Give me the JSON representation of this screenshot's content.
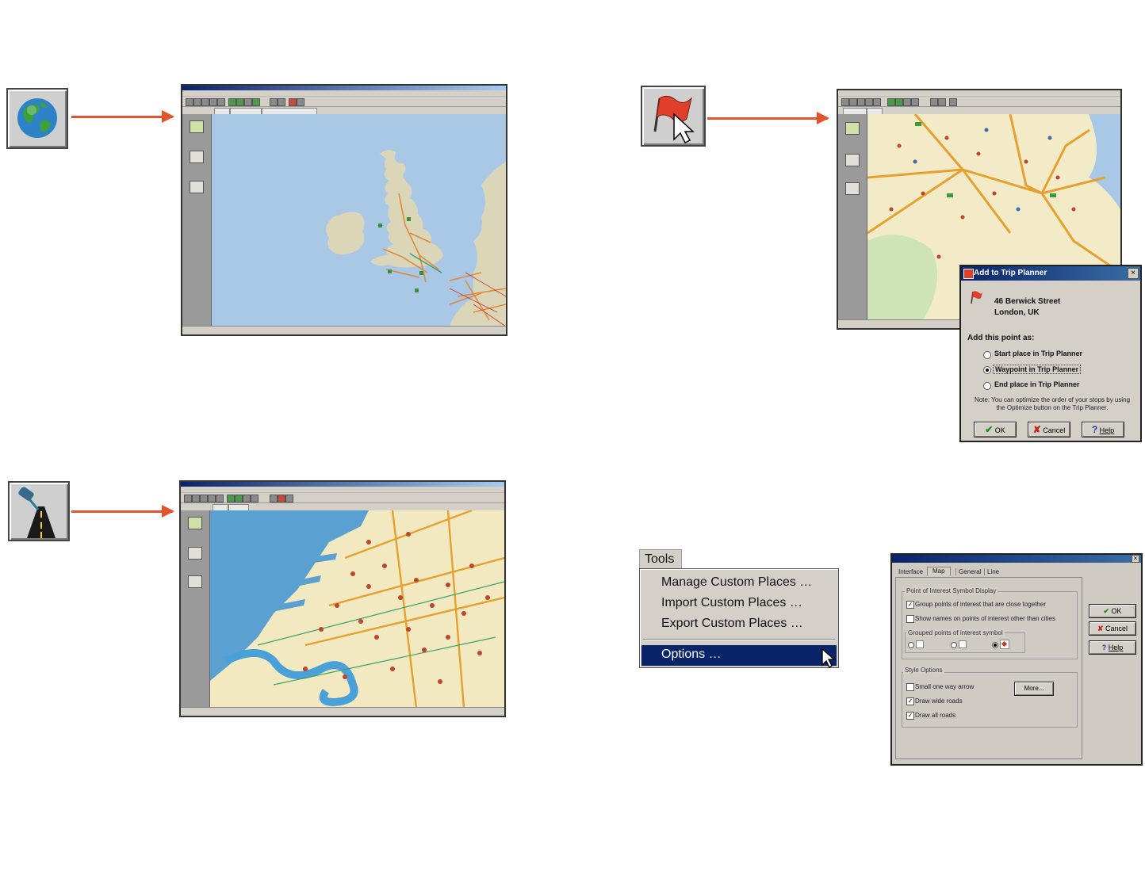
{
  "arrow_color": "#e0542e",
  "panels": {
    "top_left": {
      "icon": "globe-icon",
      "map_colors": {
        "water": "#a8c8e6",
        "land": "#dcd6b8",
        "road": "#e08a3a"
      }
    },
    "bottom_left": {
      "icon": "street-zoom-icon",
      "map_colors": {
        "water": "#5aa0d0",
        "land": "#f3e9c0",
        "river": "#4aa0d8",
        "poi": "#c0442c"
      }
    },
    "top_right": {
      "icon": "red-flag-cursor-icon",
      "dialog": {
        "title": "Add to Trip Planner",
        "address_line1": "46 Berwick Street",
        "address_line2": "London, UK",
        "prompt": "Add this point as:",
        "options": [
          {
            "label": "Start place in Trip Planner",
            "selected": false
          },
          {
            "label": "Waypoint in Trip Planner",
            "selected": true
          },
          {
            "label": "End place in Trip Planner",
            "selected": false
          }
        ],
        "note": "Note: You can optimize the order of your stops by using the Optimize button on the Trip Planner.",
        "ok_label": "OK",
        "cancel_label": "Cancel",
        "help_label": "Help",
        "close_glyph": "×"
      }
    },
    "bottom_right": {
      "tools_menu": {
        "header": "Tools",
        "items": [
          "Manage Custom Places …",
          "Import Custom Places …",
          "Export Custom Places …"
        ],
        "highlighted_item": "Options …"
      },
      "options_dialog": {
        "tabs": [
          "Interface",
          "Map",
          "General",
          "Line"
        ],
        "active_tab": "Map",
        "poi_group_label": "Point of Interest Symbol Display",
        "poi_checks": [
          {
            "label": "Group points of interest that are close together",
            "checked": true
          },
          {
            "label": "Show names on points of interest other than cities",
            "checked": false
          }
        ],
        "grouped_label": "Grouped points of interest symbol",
        "style_group_label": "Style Options",
        "style_checks": [
          {
            "label": "Small one way arrow",
            "checked": false
          },
          {
            "label": "Draw wide roads",
            "checked": true
          },
          {
            "label": "Draw all roads",
            "checked": true
          }
        ],
        "more_label": "More...",
        "ok_label": "OK",
        "cancel_label": "Cancel",
        "help_label": "Help"
      }
    }
  }
}
